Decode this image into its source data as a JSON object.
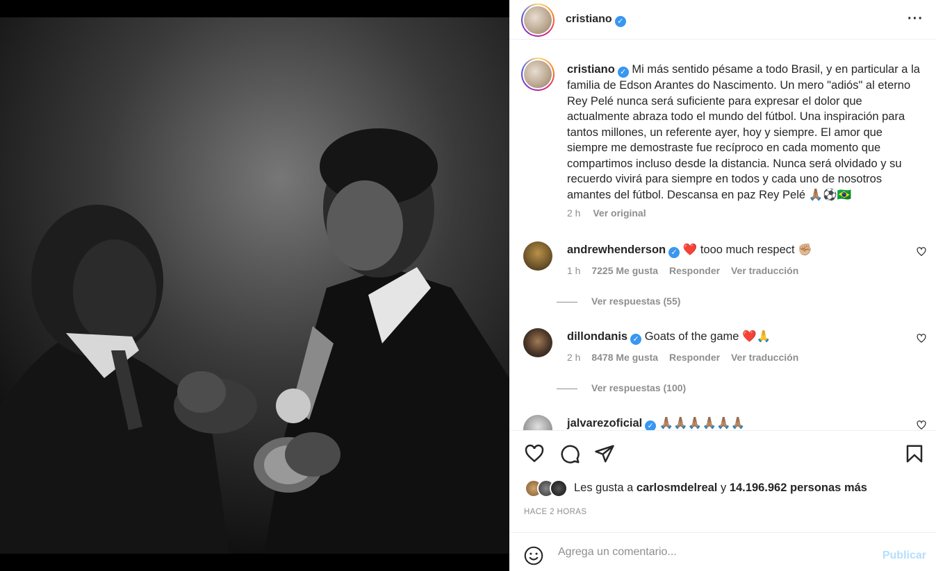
{
  "post": {
    "author": "cristiano",
    "verified": true,
    "more_icon": "more-horizontal-icon"
  },
  "caption": {
    "username": "cristiano",
    "text": "Mi más sentido pésame a todo Brasil, y en particular a la familia de Edson Arantes do Nascimento. Un mero \"adiós\" al eterno Rey Pelé nunca será suficiente para expresar el dolor que actualmente abraza todo el mundo del fútbol. Una inspiración para tantos millones, un referente ayer, hoy y siempre. El amor que siempre me demostraste fue recíproco en cada momento que compartimos incluso desde la distancia. Nunca será olvidado y su recuerdo vivirá para siempre en todos y cada uno de nosotros amantes del fútbol. Descansa en paz Rey Pelé 🙏🏽⚽🇧🇷",
    "time": "2 h",
    "see_original": "Ver original"
  },
  "comments": [
    {
      "username": "andrewhenderson",
      "text": "❤️ tooo much respect ✊🏼",
      "time": "1 h",
      "likes": "7225 Me gusta",
      "reply": "Responder",
      "translate": "Ver traducción",
      "view_replies": "Ver respuestas (55)"
    },
    {
      "username": "dillondanis",
      "text": "Goats of the game ❤️🙏",
      "time": "2 h",
      "likes": "8478 Me gusta",
      "reply": "Responder",
      "translate": "Ver traducción",
      "view_replies": "Ver respuestas (100)"
    },
    {
      "username": "jalvarezoficial",
      "text": "🙏🏽🙏🏽🙏🏽🙏🏽🙏🏽🙏🏽"
    }
  ],
  "actions": {
    "like_icon": "heart-icon",
    "comment_icon": "comment-icon",
    "share_icon": "send-icon",
    "save_icon": "bookmark-icon"
  },
  "likes": {
    "prefix": "Les gusta a",
    "user": "carlosmdelreal",
    "middle": "y",
    "count": "14.196.962 personas más"
  },
  "timestamp": "HACE 2 HORAS",
  "comment_box": {
    "placeholder": "Agrega un comentario...",
    "publish": "Publicar",
    "emoji_icon": "smiley-icon"
  },
  "colors": {
    "accent": "#0095f6",
    "publish_disabled": "#b2dffc",
    "verified": "#3897f0",
    "heart_red": "#ed4956"
  }
}
